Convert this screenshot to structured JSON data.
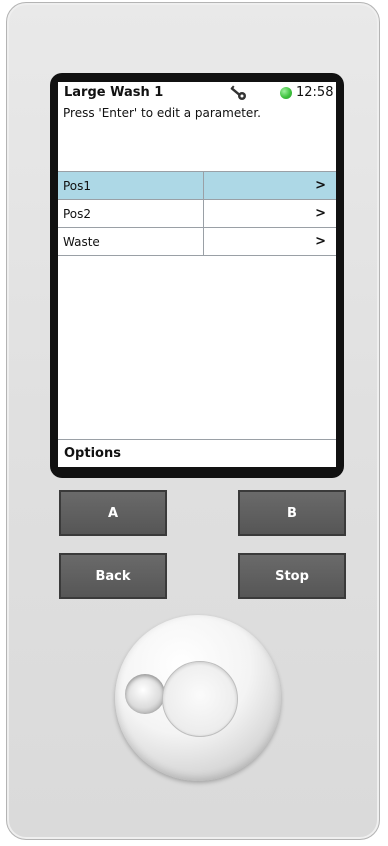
{
  "screen": {
    "title": "Large Wash 1",
    "time": "12:58",
    "status_color": "#3fc23f",
    "key_icon": "wrench-key-icon",
    "instruction": "Press 'Enter' to edit a parameter.",
    "items": [
      {
        "label": "Pos1",
        "arrow": ">",
        "selected": true
      },
      {
        "label": "Pos2",
        "arrow": ">",
        "selected": false
      },
      {
        "label": "Waste",
        "arrow": ">",
        "selected": false
      }
    ],
    "options_label": "Options",
    "selection_color": "#add8e6"
  },
  "buttons": {
    "a_label": "A",
    "b_label": "B",
    "back_label": "Back",
    "stop_label": "Stop"
  }
}
